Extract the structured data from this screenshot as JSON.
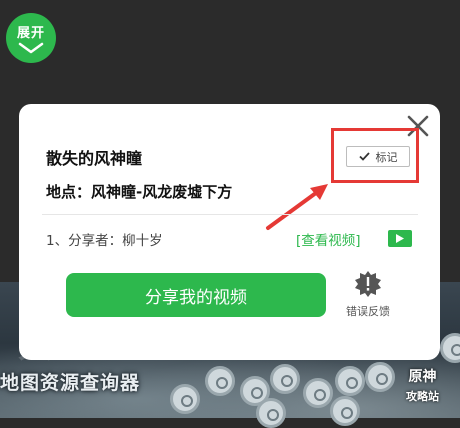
{
  "expand": {
    "label": "展开"
  },
  "popup": {
    "title": "散失的风神瞳",
    "location": "地点：风神瞳-风龙废墟下方",
    "mark_label": "标记",
    "sharer": "1、分享者：柳十岁",
    "view_video": "[查看视频]",
    "share_button": "分享我的视频",
    "report_label": "错误反馈"
  },
  "map": {
    "title": "地图资源查询器",
    "brand_line1": "原神",
    "brand_line2": "攻略站"
  },
  "colors": {
    "accent_green": "#2db84d",
    "highlight_red": "#e53935",
    "backdrop": "#2b2b2b"
  },
  "icons": [
    "chevron-down-icon",
    "close-icon",
    "check-icon",
    "play-icon",
    "gear-alert-icon",
    "map-pin-icon"
  ]
}
